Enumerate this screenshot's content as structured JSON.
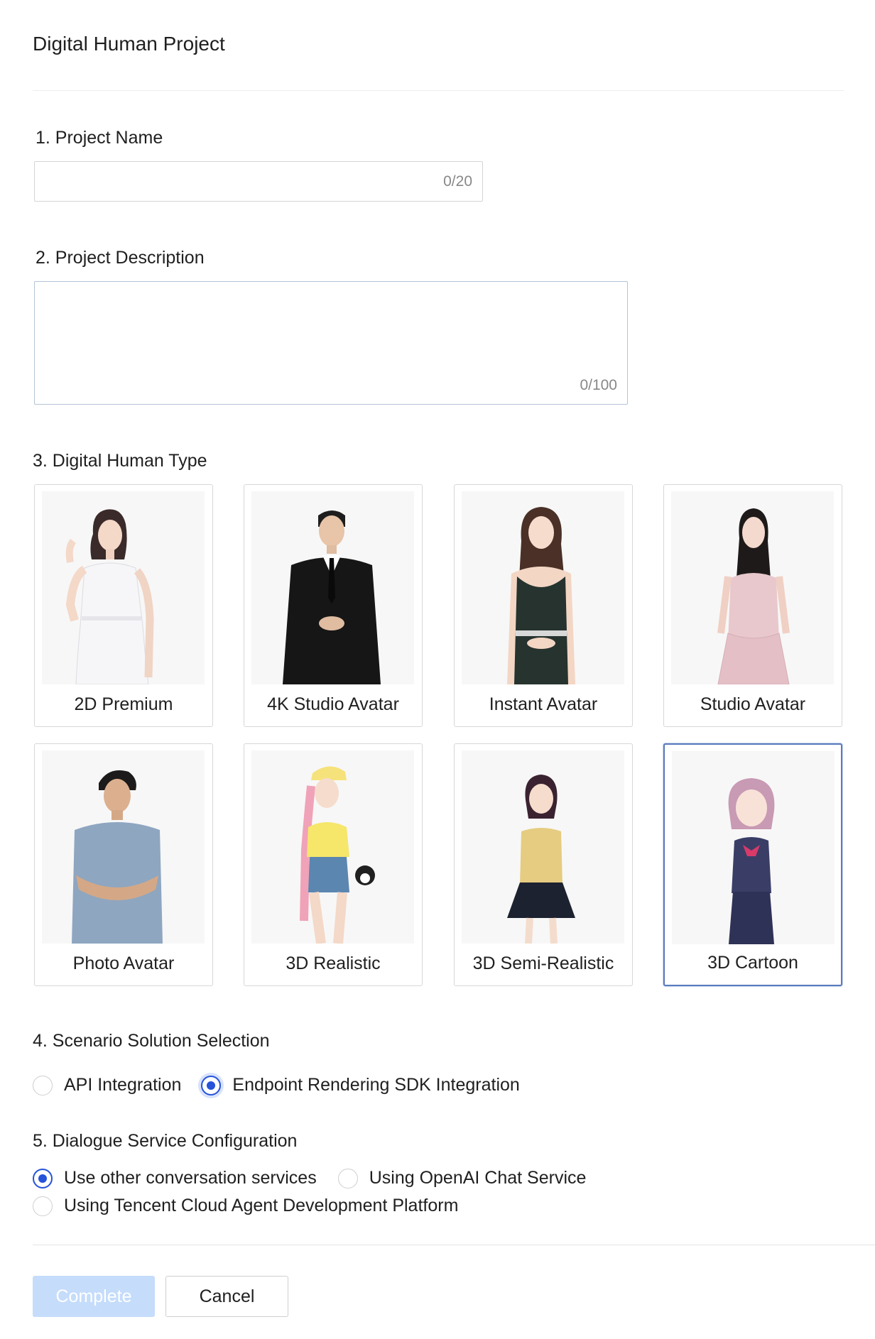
{
  "page": {
    "title": "Digital Human Project"
  },
  "project_name": {
    "label": "1. Project Name",
    "value": "",
    "counter": "0/20"
  },
  "project_description": {
    "label": "2. Project Description",
    "value": "",
    "counter": "0/100"
  },
  "human_type": {
    "label": "3. Digital Human Type",
    "selected": "3D Cartoon",
    "cards": [
      {
        "label": "2D Premium",
        "figure": "woman-white-dress"
      },
      {
        "label": "4K Studio Avatar",
        "figure": "man-black-suit"
      },
      {
        "label": "Instant Avatar",
        "figure": "woman-black-dress"
      },
      {
        "label": "Studio Avatar",
        "figure": "woman-pink-dress"
      },
      {
        "label": "Photo Avatar",
        "figure": "man-blue-tshirt"
      },
      {
        "label": "3D Realistic",
        "figure": "girl-pink-hair-cap"
      },
      {
        "label": "3D Semi-Realistic",
        "figure": "girl-school-uniform"
      },
      {
        "label": "3D Cartoon",
        "figure": "girl-purple-bob"
      }
    ]
  },
  "scenario": {
    "label": "4. Scenario Solution Selection",
    "options": [
      {
        "label": "API Integration",
        "checked": false
      },
      {
        "label": "Endpoint Rendering SDK Integration",
        "checked": true
      }
    ]
  },
  "dialogue": {
    "label": "5. Dialogue Service Configuration",
    "options": [
      {
        "label": "Use other conversation services",
        "checked": true
      },
      {
        "label": "Using OpenAI Chat Service",
        "checked": false
      },
      {
        "label": "Using Tencent Cloud Agent Development Platform",
        "checked": false
      }
    ]
  },
  "footer": {
    "complete_label": "Complete",
    "cancel_label": "Cancel"
  },
  "colors": {
    "accent": "#2653d9",
    "primary_disabled": "#c5dcfb",
    "selected_card_border": "#5b7bbd"
  }
}
